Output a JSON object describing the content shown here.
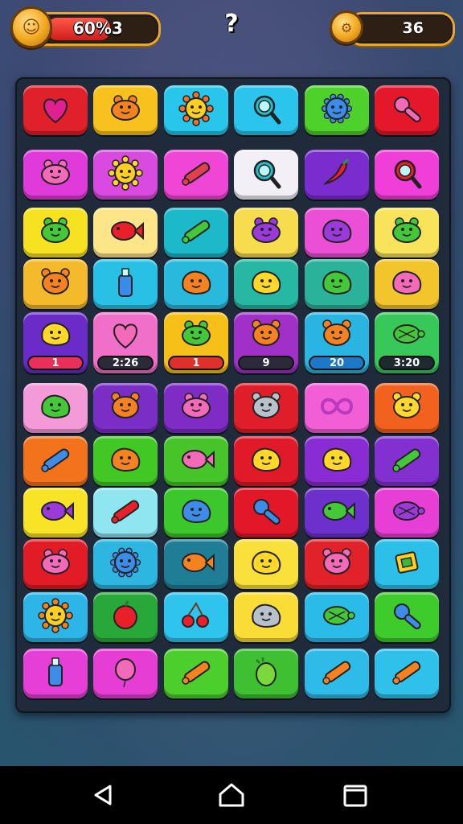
{
  "hud": {
    "progress_text": "60%3",
    "progress_value": 0.6,
    "coins": "36",
    "help_glyph": "?"
  },
  "board": {
    "rows": [
      [
        {
          "color": "#e0202a",
          "icon": "heart-balloon-icon"
        },
        {
          "color": "#f7c21e",
          "icon": "orange-frog-icon"
        },
        {
          "color": "#27c6ea",
          "icon": "sun-smiley-icon"
        },
        {
          "color": "#2ac4ec",
          "icon": "magnifier-candy-icon"
        },
        {
          "color": "#4fd12c",
          "icon": "blue-spiky-monster-icon"
        },
        {
          "color": "#e4182a",
          "icon": "pink-ice-cream-icon"
        }
      ],
      [
        {
          "color": "#e13adb",
          "icon": "pink-frog-icon"
        },
        {
          "color": "#d84ae0",
          "icon": "yellow-sun-smiley-icon"
        },
        {
          "color": "#f046d6",
          "icon": "pencil-icon"
        },
        {
          "color": "#f2f0f6",
          "icon": "magnifier-icon"
        },
        {
          "color": "#7b2ccf",
          "icon": "red-chili-icon"
        },
        {
          "color": "#ef3fd8",
          "icon": "red-magnifier-icon"
        }
      ],
      [
        {
          "color": "#f7e221",
          "icon": "green-frog-icon"
        },
        {
          "color": "#fde58a",
          "icon": "red-fish-icon"
        },
        {
          "color": "#1bb9c9",
          "icon": "green-leaf-icon"
        },
        {
          "color": "#f7dc4e",
          "icon": "purple-frog-icon"
        },
        {
          "color": "#ea4fd6",
          "icon": "purple-blob-icon"
        },
        {
          "color": "#f9e35a",
          "icon": "green-frog-icon"
        }
      ],
      [
        {
          "color": "#f5b92c",
          "icon": "orange-bear-icon"
        },
        {
          "color": "#29c0e6",
          "icon": "potion-bottle-icon"
        },
        {
          "color": "#28b9dc",
          "icon": "orange-blob-icon"
        },
        {
          "color": "#26b8a3",
          "icon": "yellow-blob-icon"
        },
        {
          "color": "#2bb29b",
          "icon": "green-blob-icon"
        },
        {
          "color": "#f3c52c",
          "icon": "pink-blob-icon"
        }
      ],
      [
        {
          "color": "#6a2bc8",
          "icon": "yellow-blob-icon",
          "counter": "1",
          "counter_color": "#e8305a"
        },
        {
          "color": "#f06fc8",
          "icon": "pink-heart-icon",
          "counter": "2:26",
          "counter_color": "#2a2a3a"
        },
        {
          "color": "#f7c018",
          "icon": "green-frog-icon",
          "counter": "1",
          "counter_color": "#e0302c"
        },
        {
          "color": "#a030c8",
          "icon": "orange-bear-icon",
          "counter": "9",
          "counter_color": "#2a2a3a"
        },
        {
          "color": "#2ab4e2",
          "icon": "orange-bear-icon",
          "counter": "20",
          "counter_color": "#1e78c8"
        },
        {
          "color": "#38c85a",
          "icon": "green-turtle-icon",
          "counter": "3:20",
          "counter_color": "#1e2a32"
        }
      ],
      [
        {
          "color": "#f59ad8",
          "icon": "green-blob-icon"
        },
        {
          "color": "#7a2ec6",
          "icon": "orange-bear-icon"
        },
        {
          "color": "#7e2cc4",
          "icon": "pink-frog-icon"
        },
        {
          "color": "#e01e2a",
          "icon": "gray-bear-icon"
        },
        {
          "color": "#f25ed6",
          "icon": "infinity-icon"
        },
        {
          "color": "#f2611e",
          "icon": "yellow-bear-icon"
        }
      ],
      [
        {
          "color": "#f2731c",
          "icon": "blue-roller-icon"
        },
        {
          "color": "#42c824",
          "icon": "orange-blob-icon"
        },
        {
          "color": "#46c42a",
          "icon": "pink-fish-icon"
        },
        {
          "color": "#e01a28",
          "icon": "yellow-blob-icon"
        },
        {
          "color": "#8a2cd4",
          "icon": "yellow-blob-icon"
        },
        {
          "color": "#8230d0",
          "icon": "green-wand-icon"
        }
      ],
      [
        {
          "color": "#f8e326",
          "icon": "purple-fish-icon"
        },
        {
          "color": "#8fe6f0",
          "icon": "red-bone-icon"
        },
        {
          "color": "#3cc82c",
          "icon": "blue-blob-icon"
        },
        {
          "color": "#e21828",
          "icon": "blue-candy-icon"
        },
        {
          "color": "#6e30cc",
          "icon": "green-fish-icon"
        },
        {
          "color": "#e73fd6",
          "icon": "purple-turtle-icon"
        }
      ],
      [
        {
          "color": "#e21c26",
          "icon": "pink-frog-icon"
        },
        {
          "color": "#2cb6e0",
          "icon": "blue-spiky-icon"
        },
        {
          "color": "#1f7e96",
          "icon": "orange-fish-icon"
        },
        {
          "color": "#f9e03a",
          "icon": "yellow-blob-icon"
        },
        {
          "color": "#e2222a",
          "icon": "pink-bear-icon"
        },
        {
          "color": "#2cc0e8",
          "icon": "yellow-box-icon"
        }
      ],
      [
        {
          "color": "#2cb5e6",
          "icon": "orange-sun-smiley-icon"
        },
        {
          "color": "#28a838",
          "icon": "red-apple-icon"
        },
        {
          "color": "#2fc4ee",
          "icon": "red-cherries-icon"
        },
        {
          "color": "#f9dd36",
          "icon": "gray-blob-icon"
        },
        {
          "color": "#2abbe8",
          "icon": "green-turtle-icon"
        },
        {
          "color": "#3ecc2c",
          "icon": "blue-candy-icon"
        }
      ],
      [
        {
          "color": "#e63fd8",
          "icon": "blue-bottle-icon"
        },
        {
          "color": "#e63ed4",
          "icon": "pink-balloon-icon"
        },
        {
          "color": "#4ccf2c",
          "icon": "orange-bone-icon"
        },
        {
          "color": "#3fbf32",
          "icon": "green-cactus-icon"
        },
        {
          "color": "#2ebbe8",
          "icon": "orange-carrot-icon"
        },
        {
          "color": "#2fc1ea",
          "icon": "orange-carrot-icon"
        }
      ]
    ]
  },
  "navbar": {
    "back_icon": "back-triangle-icon",
    "home_icon": "home-icon",
    "recents_icon": "recents-icon"
  }
}
